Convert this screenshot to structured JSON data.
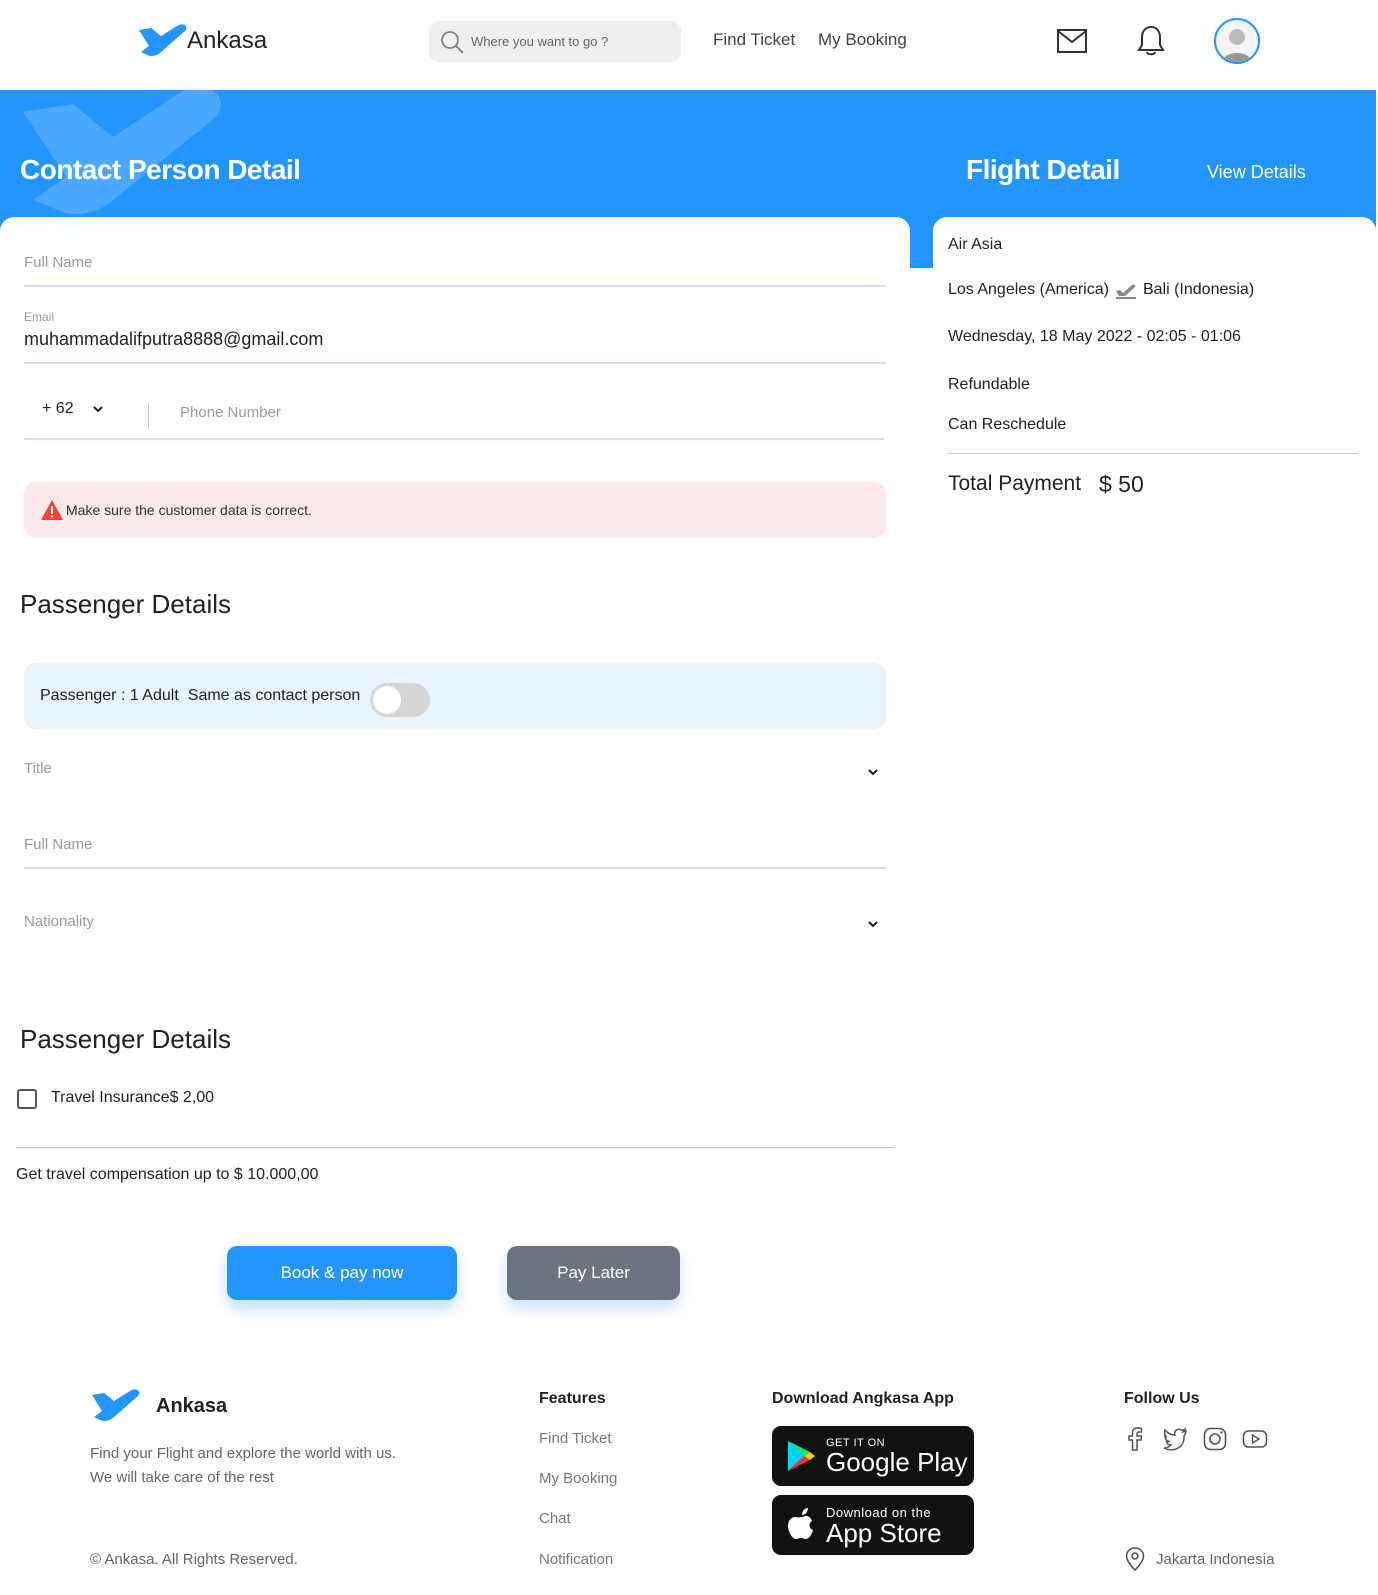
{
  "brand": {
    "name": "Ankasa",
    "accent": "#2395ff"
  },
  "navbar": {
    "search_placeholder": "Where you want to go ?",
    "links": [
      "Find Ticket",
      "My Booking"
    ],
    "icons": [
      "mail-icon",
      "bell-icon",
      "avatar"
    ]
  },
  "contact": {
    "title": "Contact Person Detail",
    "full_name_label": "Full Name",
    "email_label": "Email",
    "email_value": "muhammadalifputra8888@gmail.com",
    "phone_code": "+ 62",
    "phone_placeholder": "Phone Number",
    "warning": "Make sure the customer data is correct."
  },
  "passenger": {
    "title": "Passenger Details",
    "info": "Passenger : 1 Adult",
    "same_as_contact": "Same as contact person",
    "same_as_contact_on": false,
    "title_label": "Title",
    "full_name_label": "Full Name",
    "nationality_label": "Nationality"
  },
  "insurance": {
    "title": "Passenger Details",
    "checkbox_label": "Travel Insurance",
    "price": "$ 2,00",
    "checked": false,
    "compensation": "Get travel compensation up to $ 10.000,00"
  },
  "actions": {
    "book": "Book & pay now",
    "later": "Pay Later",
    "later_color": "#6b7480"
  },
  "flight": {
    "title": "Flight Detail",
    "view_details": "View Details",
    "airline": "Air Asia",
    "origin": "Los Angeles (America)",
    "destination": "Bali (Indonesia)",
    "datetime": "Wednesday, 18 May 2022 - 02:05 - 01:06",
    "refundable": "Refundable",
    "reschedule": "Can Reschedule",
    "total_label": "Total Payment",
    "total_value": "$ 50"
  },
  "footer": {
    "brand": "Ankasa",
    "description": "Find your Flight and explore the world with us. We will take care of the rest",
    "copyright": "© Ankasa. All Rights Reserved.",
    "features_title": "Features",
    "features": [
      "Find Ticket",
      "My Booking",
      "Chat",
      "Notification"
    ],
    "download_title": "Download Angkasa App",
    "google_small": "GET IT ON",
    "google_big": "Google Play",
    "apple_small": "Download on the",
    "apple_big": "App Store",
    "follow_title": "Follow Us",
    "social_icons": [
      "facebook-icon",
      "twitter-icon",
      "instagram-icon",
      "youtube-icon"
    ],
    "location": "Jakarta Indonesia"
  }
}
